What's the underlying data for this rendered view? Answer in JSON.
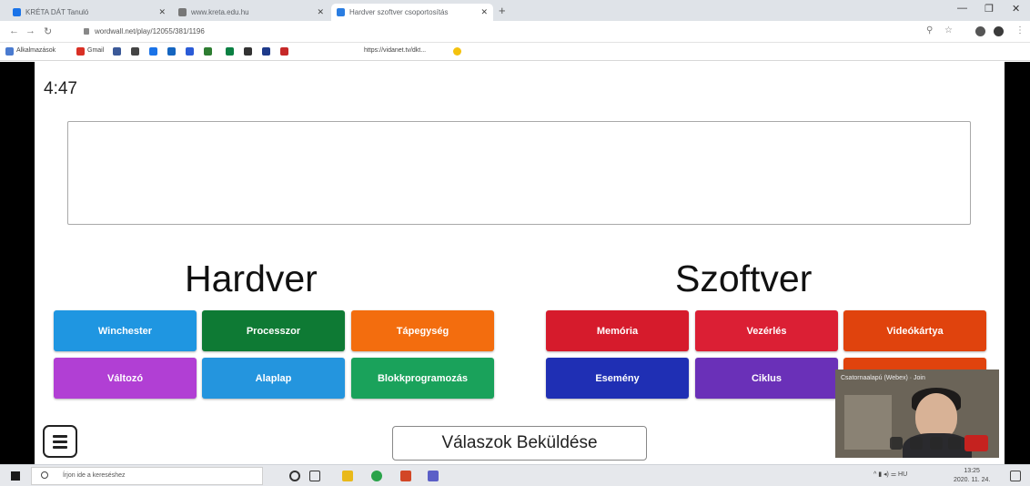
{
  "browser": {
    "tabs": [
      {
        "title": "KRÉTA DÁT Tanuló",
        "active": false
      },
      {
        "title": "www.kreta.edu.hu",
        "active": false
      },
      {
        "title": "Hardver szoftver csoportosítás",
        "active": true
      }
    ],
    "url": "wordwall.net/play/12055/381/1196",
    "bookmarks_label": "Alkalmazások",
    "bookmark_gmail": "Gmail",
    "bookmark_link": "https://vidanet.tv/dkt..."
  },
  "game": {
    "timer": "4:47",
    "groups": [
      {
        "title": "Hardver"
      },
      {
        "title": "Szoftver"
      }
    ],
    "tiles_left": [
      {
        "label": "Winchester",
        "color": "#1f96e1"
      },
      {
        "label": "Processzor",
        "color": "#0e7a34"
      },
      {
        "label": "Tápegység",
        "color": "#f36d0e"
      },
      {
        "label": "Változó",
        "color": "#b13fd4"
      },
      {
        "label": "Alaplap",
        "color": "#2495de"
      },
      {
        "label": "Blokkprogramozás",
        "color": "#1aa25b"
      }
    ],
    "tiles_right": [
      {
        "label": "Memória",
        "color": "#d61b2c"
      },
      {
        "label": "Vezérlés",
        "color": "#db1f34"
      },
      {
        "label": "Videókártya",
        "color": "#e0430d"
      },
      {
        "label": "Esemény",
        "color": "#1f2fb4"
      },
      {
        "label": "Ciklus",
        "color": "#6a30b8"
      }
    ],
    "submit_label": "Válaszok Beküldése"
  },
  "video_call": {
    "title": "Csatornaalapú (Webex) · Join"
  },
  "taskbar": {
    "search_placeholder": "Írjon ide a kereséshez",
    "time": "13:25",
    "date": "2020. 11. 24."
  }
}
